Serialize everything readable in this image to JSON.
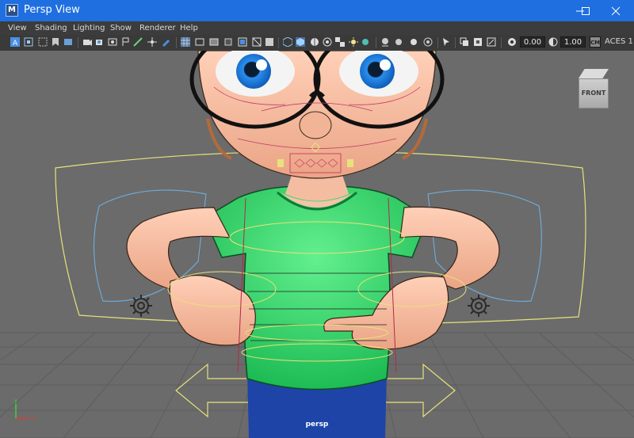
{
  "window": {
    "title": "Persp View",
    "app_icon_letter": "M"
  },
  "menu": {
    "items": [
      "View",
      "Shading",
      "Lighting",
      "Show",
      "Renderer",
      "Help"
    ]
  },
  "toolbar": {
    "exposure_value": "0.00",
    "gamma_value": "1.00",
    "color_space": "ACES 1",
    "color_management_badge": "CM"
  },
  "viewport": {
    "view_cube_label": "FRONT",
    "camera_label": "persp",
    "background_color": "#6b6b6b"
  },
  "colors": {
    "titlebar": "#1f6fe0",
    "shirt": "#2fd26a",
    "pants": "#1e44a8",
    "rig_yellow": "#e8e27a",
    "rig_blue": "#6fb3e6"
  }
}
